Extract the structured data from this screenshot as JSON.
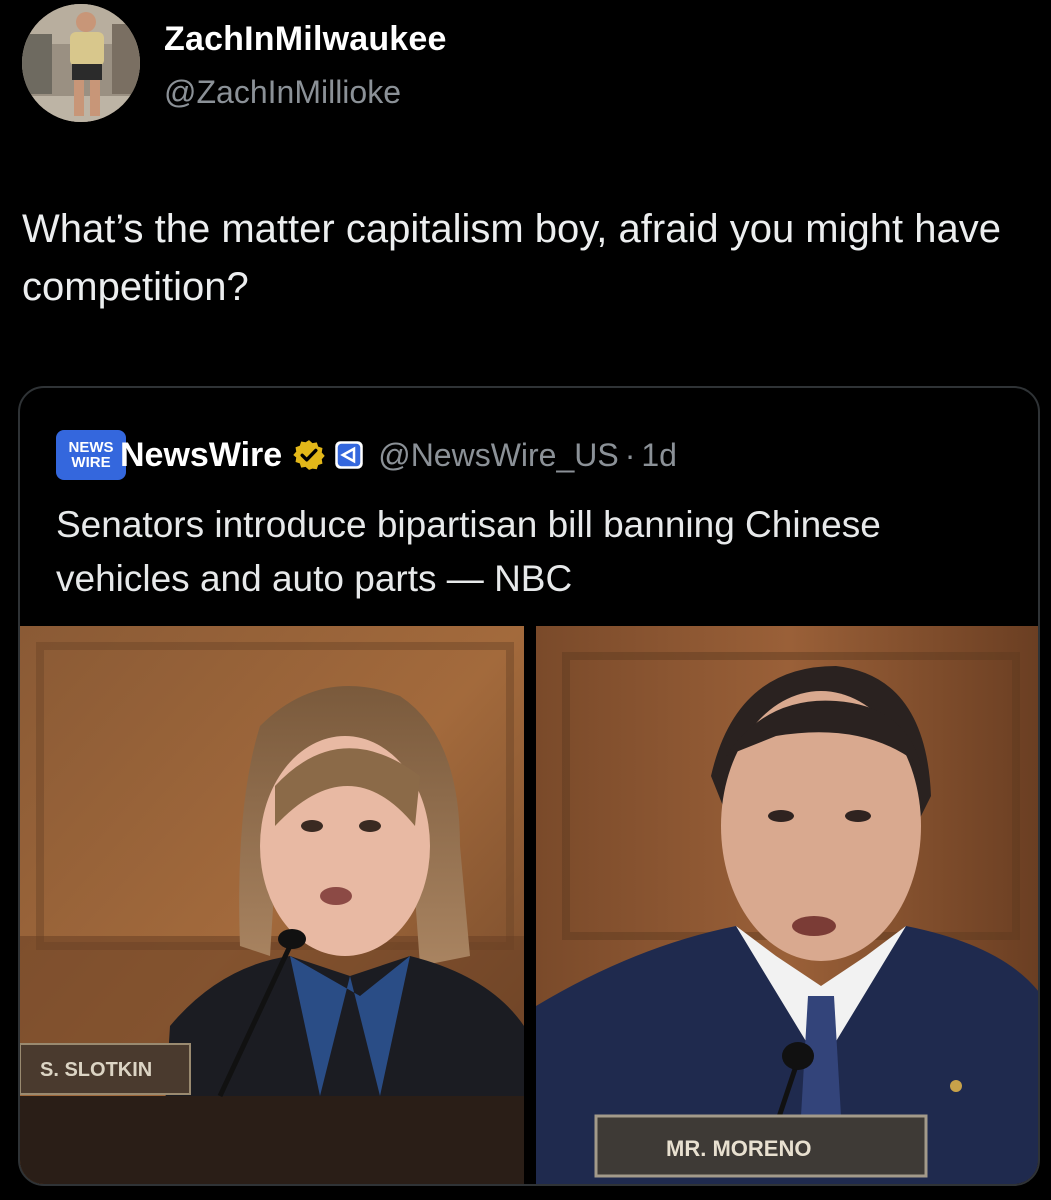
{
  "author": {
    "display_name": "ZachInMilwaukee",
    "handle": "@ZachInMillioke"
  },
  "tweet": {
    "text": "What’s the matter capitalism boy, afraid you might have competition?"
  },
  "quoted_tweet": {
    "logo_line1": "NEWS",
    "logo_line2": "WIRE",
    "display_name": "NewsWire",
    "handle": "@NewsWire_US",
    "dot": "·",
    "time": "1d",
    "text": "Senators introduce bipartisan bill banning Chinese vehicles and auto parts — NBC",
    "photos": {
      "left_nameplate": "S. SLOTKIN",
      "right_nameplate": "MR. MORENO"
    }
  },
  "icons": {
    "verified": "verified-badge-icon",
    "affiliate": "affiliate-badge-icon"
  },
  "colors": {
    "background": "#000000",
    "text_primary": "#e7e9ea",
    "text_secondary": "#8b9197",
    "card_border": "#2f3336",
    "verified_gold": "#e2b719",
    "logo_blue": "#3467dd"
  }
}
